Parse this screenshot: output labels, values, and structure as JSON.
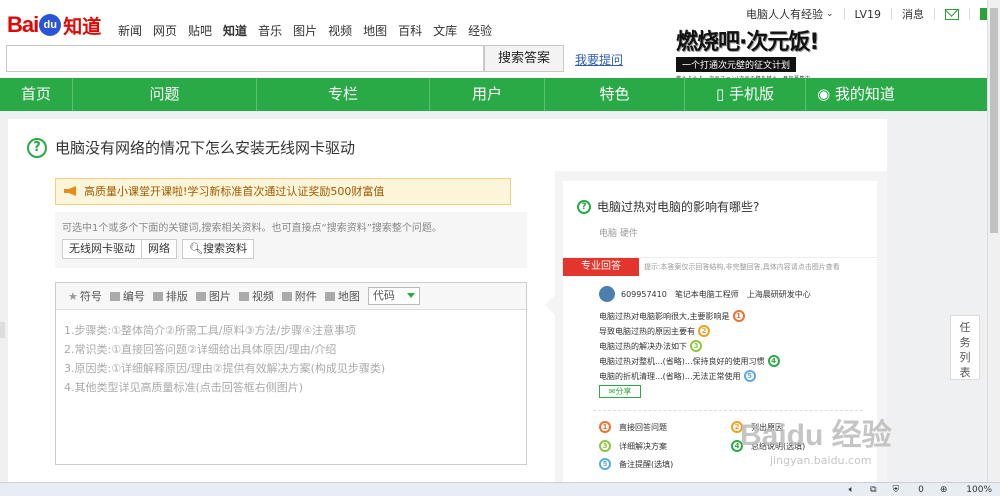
{
  "header": {
    "logo_bai": "Bai",
    "logo_du": "du",
    "logo_zd": "知道",
    "nav": [
      "新闻",
      "网页",
      "贴吧",
      "知道",
      "音乐",
      "图片",
      "视频",
      "地图",
      "百科",
      "文库",
      "经验"
    ],
    "active_nav": "知道",
    "search_button": "搜索答案",
    "ask_link": "我要提问"
  },
  "banner": {
    "title": "燃烧吧·次元饭!",
    "subtitle": "一个打通次元壁的征文计划",
    "small": "燃えようよ、次元ファン!次元の壁を越え、参加募集中"
  },
  "userbar": {
    "username": "电脑人人有经验",
    "level": "LV19",
    "messages": "消息"
  },
  "greennav": {
    "items": [
      "首页",
      "问题",
      "专栏",
      "用户",
      "特色"
    ],
    "mobile": "手机版",
    "mine": "我的知道"
  },
  "question": {
    "title": "电脑没有网络的情况下怎么安装无线网卡驱动"
  },
  "notice": {
    "text": "高质量小课堂开课啦!学习新标准首次通过认证奖励500财富值"
  },
  "keywords": {
    "hint": "可选中1个或多个下面的关键词,搜索相关资料。也可直接点“搜索资料”搜索整个问题。",
    "items": [
      "无线网卡驱动",
      "网络"
    ],
    "search_label": "搜索资料"
  },
  "editor": {
    "toolbar": [
      "符号",
      "编号",
      "排版",
      "图片",
      "视频",
      "附件",
      "地图"
    ],
    "code_select": "代码",
    "lines": [
      "1.步骤类:①整体简介②所需工具/原料③方法/步骤④注意事项",
      "2.常识类:①直接回答问题②详细给出具体原因/理由/介绍",
      "3.原因类:①详细解释原因/理由②提供有效解决方案(构成见步骤类)",
      "4.其他类型详见高质量标准(点击回答框右侧图片)"
    ]
  },
  "guide": {
    "question": "电脑过热对电脑的影响有哪些?",
    "tags": "电脑   硬件",
    "pro_tab": "专业回答",
    "pro_tip": "提示:本答案仅示回答结构,非完整回答,具体内容请点击图片查看",
    "user_id": "609957410",
    "user_title": "笔记本电脑工程师",
    "user_org": "上海晨研研发中心",
    "points": [
      {
        "text": "电脑过热对电脑影响很大,主要影响是",
        "n": "1",
        "color": "#f07030"
      },
      {
        "text": "导致电脑过热的原因主要有",
        "n": "2",
        "color": "#f0a020"
      },
      {
        "text": "电脑过热的解决办法如下",
        "n": "3",
        "color": "#8cc63e"
      },
      {
        "text": "电脑过热对整机...(省略)...保持良好的使用习惯",
        "n": "4",
        "color": "#2aaa46"
      },
      {
        "text": "电脑的折机清理...(省略)...无法正常使用",
        "n": "5",
        "color": "#5fa8e0"
      }
    ],
    "share": "分享",
    "legend": [
      {
        "n": "1",
        "text": "直接回答问题",
        "color": "#f07030"
      },
      {
        "n": "2",
        "text": "列出原因",
        "color": "#f0a020"
      },
      {
        "n": "3",
        "text": "详细解决方案",
        "color": "#8cc63e"
      },
      {
        "n": "4",
        "text": "总结说明(选填)",
        "color": "#2aaa46"
      },
      {
        "n": "5",
        "text": "备注提醒(选填)",
        "color": "#5fa8e0"
      }
    ]
  },
  "taskbtn": "任务列表",
  "watermark": {
    "big": "Baidu 经验",
    "url": "jingyan.baidu.com"
  },
  "status": {
    "count": "0",
    "zoom": "100%"
  },
  "colors": {
    "brand_green": "#2aaa46",
    "baidu_red": "#e10602",
    "pro_red": "#e3352b"
  }
}
